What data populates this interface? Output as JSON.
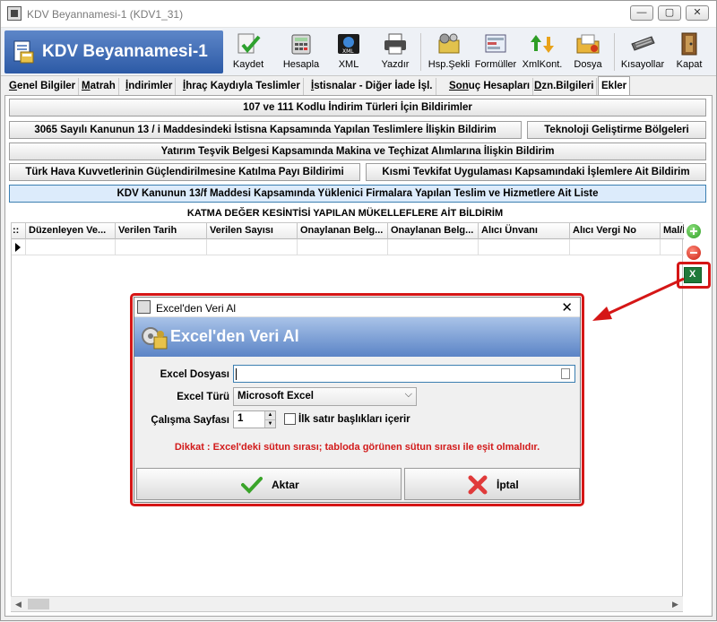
{
  "window": {
    "title": "KDV Beyannamesi-1 (KDV1_31)",
    "min": "—",
    "max": "▢",
    "close": "✕"
  },
  "brand": {
    "title": "KDV Beyannamesi-1"
  },
  "toolbar": [
    {
      "label": "Kaydet",
      "icon": "save-check-icon"
    },
    {
      "label": "Hesapla",
      "icon": "calculator-icon"
    },
    {
      "label": "XML",
      "icon": "xml-globe-icon"
    },
    {
      "label": "Yazdır",
      "icon": "printer-icon"
    },
    {
      "label": "Hsp.Şekli",
      "icon": "calc-method-icon"
    },
    {
      "label": "Formüller",
      "icon": "formula-icon"
    },
    {
      "label": "XmlKont.",
      "icon": "xml-check-icon"
    },
    {
      "label": "Dosya",
      "icon": "folder-icon"
    },
    {
      "label": "Kısayollar",
      "icon": "keyboard-icon"
    },
    {
      "label": "Kapat",
      "icon": "exit-door-icon"
    }
  ],
  "tabs": [
    {
      "u": "G",
      "rest": "enel Bilgiler"
    },
    {
      "u": "M",
      "rest": "atrah"
    },
    {
      "u": "İ",
      "rest": "ndirimler"
    },
    {
      "u": "İ",
      "rest": "hraç Kaydıyla Teslimler"
    },
    {
      "u": "İ",
      "rest": "stisnalar - Diğer İade İşl."
    },
    {
      "u": "Son",
      "rest": "uç Hesapları"
    },
    {
      "u": "D",
      "rest": "zn.Bilgileri"
    },
    {
      "u": "",
      "rest": "Ekler"
    }
  ],
  "ekler_buttons": {
    "b1": "107 ve 111 Kodlu İndirim Türleri İçin Bildirimler",
    "b2": "3065 Sayılı Kanunun  13 / i  Maddesindeki İstisna Kapsamında Yapılan Teslimlere İlişkin Bildirim",
    "b3": "Teknoloji Geliştirme Bölgeleri",
    "b4": "Yatırım Teşvik Belgesi Kapsamında Makina ve Teçhizat Alımlarına İlişkin Bildirim",
    "b5": "Türk Hava Kuvvetlerinin Güçlendirilmesine Katılma Payı Bildirimi",
    "b6": "Kısmi Tevkifat Uygulaması Kapsamındaki İşlemlere Ait Bildirim",
    "b7": "KDV Kanunun 13/f Maddesi Kapsamında Yüklenici Firmalara Yapılan Teslim ve Hizmetlere Ait Liste"
  },
  "grid": {
    "title": "KATMA DEĞER KESİNTİSİ YAPILAN MÜKELLEFLERE AİT BİLDİRİM",
    "row_indicator": "::",
    "columns": [
      "Düzenleyen Ve...",
      "Verilen Tarih",
      "Verilen Sayısı",
      "Onaylanan Belg...",
      "Onaylanan Belg...",
      "Alıcı Ünvanı",
      "Alıcı Vergi No",
      "Mal/İ"
    ]
  },
  "dialog": {
    "title": "Excel'den Veri Al",
    "close": "✕",
    "banner_title": "Excel'den Veri Al",
    "file_label": "Excel Dosyası",
    "file_value": "",
    "type_label": "Excel Türü",
    "type_value": "Microsoft Excel",
    "sheet_label": "Çalışma Sayfası",
    "sheet_value": "1",
    "first_row_label": "İlk satır başlıkları içerir",
    "first_row_checked": false,
    "warning": "Dikkat : Excel'deki sütun sırası; tabloda görünen sütun sırası ile eşit olmalıdır.",
    "ok_label": "Aktar",
    "cancel_label": "İptal"
  },
  "colors": {
    "accent_red": "#d51616",
    "brand_blue": "#2c5aa6"
  }
}
